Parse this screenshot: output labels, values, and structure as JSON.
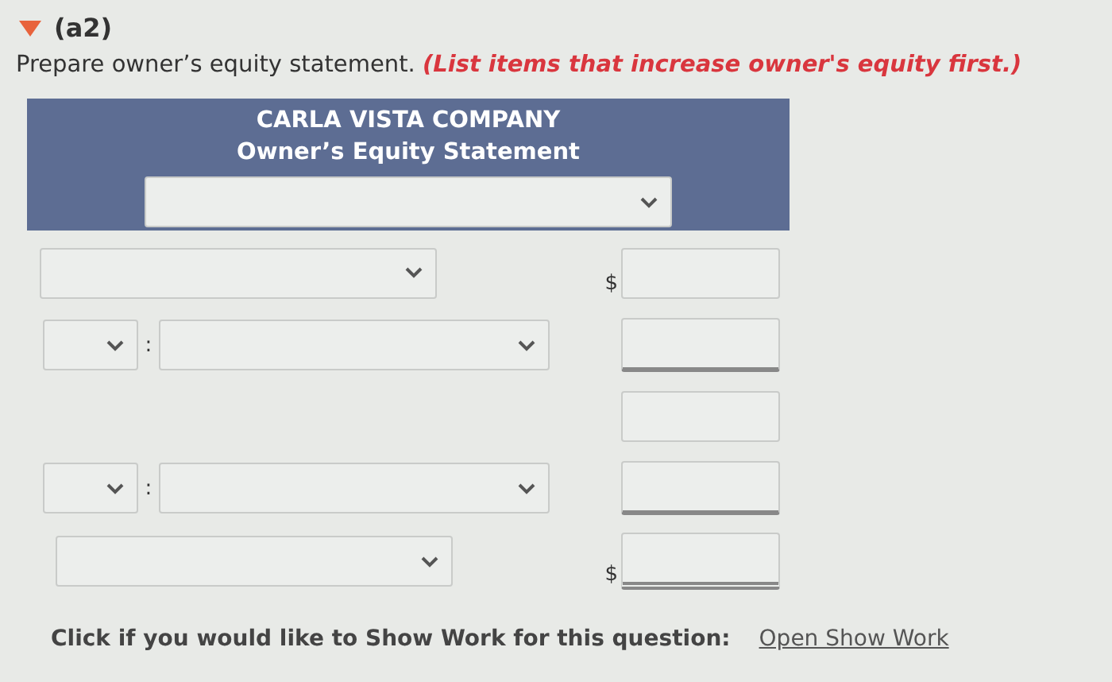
{
  "part": {
    "label": "(a2)",
    "expanded": true
  },
  "instruction": {
    "text": "Prepare owner’s equity statement.",
    "note": "(List items that increase owner's equity first.)"
  },
  "statement": {
    "company": "CARLA VISTA COMPANY",
    "title": "Owner’s Equity Statement"
  },
  "rows": [
    {
      "kind": "wide",
      "currency": "$",
      "underlined": false,
      "double_underlined": false
    },
    {
      "kind": "prefixed",
      "separator": ":",
      "underlined": true,
      "double_underlined": false
    },
    {
      "kind": "blank",
      "underlined": false,
      "double_underlined": false
    },
    {
      "kind": "prefixed",
      "separator": ":",
      "underlined": true,
      "double_underlined": false
    },
    {
      "kind": "wide",
      "currency": "$",
      "underlined": false,
      "double_underlined": true
    }
  ],
  "footer": {
    "prompt": "Click if you would like to Show Work for this question:",
    "link": "Open Show Work"
  }
}
